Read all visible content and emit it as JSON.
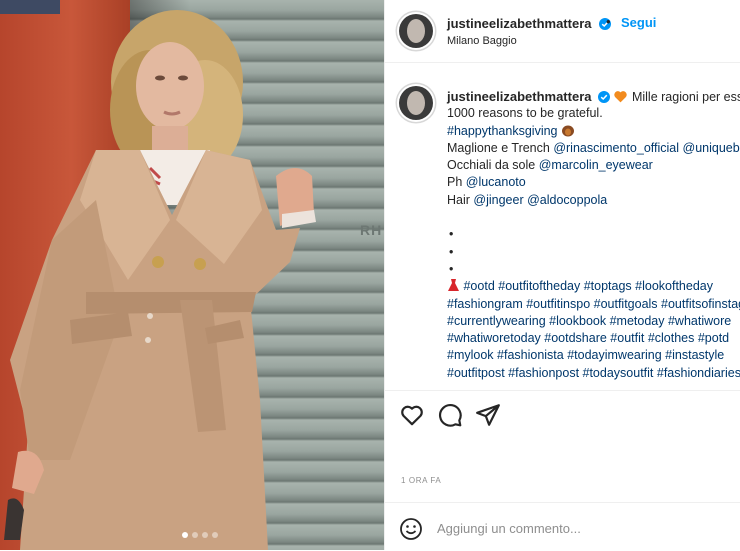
{
  "post": {
    "username": "justineelizabethmattera",
    "separator": "•",
    "follow_label": "Segui",
    "location": "Milano Baggio",
    "carousel": {
      "slides": 4,
      "active_index": 0
    },
    "photo_sign": "RH"
  },
  "caption": {
    "username": "justineelizabethmattera",
    "lines": [
      {
        "prefix_emoji": "heart",
        "text": "Mille ragioni per esser grata."
      },
      {
        "text": "1000 reasons to be grateful."
      },
      {
        "tag": "#happythanksgiving",
        "suffix_emoji": "turkey"
      },
      {
        "text": "Maglione e Trench ",
        "mention": "@rinascimento_official",
        "mention2": "@uniquebrand"
      },
      {
        "text": "Occhiali da sole ",
        "mention": "@marcolin_eyewear"
      },
      {
        "text": "Ph ",
        "mention": "@lucanoto"
      },
      {
        "text": "Hair ",
        "mention": "@jingeer",
        "mention2": "@aldocoppola"
      }
    ],
    "bullets": [
      "•",
      "•",
      "•"
    ],
    "hashtag_lines": [
      "#ootd #outfitoftheday #toptags #lookoftheday",
      "#fashiongram #outfitinspo #outfitgoals #outfitsofinstagram",
      "#currentlywearing #lookbook #metoday #whatiwore",
      "#whatiworetoday #ootdshare #outfit #clothes #potd",
      "#mylook #fashionista #todayimwearing #instastyle",
      "#outfitpost #fashionpost #todaysoutfit #fashiondiaries"
    ],
    "hashtag_prefix_emoji": "dress"
  },
  "actions": {
    "like": "heart-outline-icon",
    "comment": "comment-icon",
    "share": "paper-plane-icon"
  },
  "timestamp": "1 ORA FA",
  "comment_box": {
    "placeholder": "Aggiungi un commento..."
  },
  "colors": {
    "link": "#00376b",
    "accent": "#0095f6",
    "verified": "#0095f6",
    "muted": "#8e8e8e"
  }
}
